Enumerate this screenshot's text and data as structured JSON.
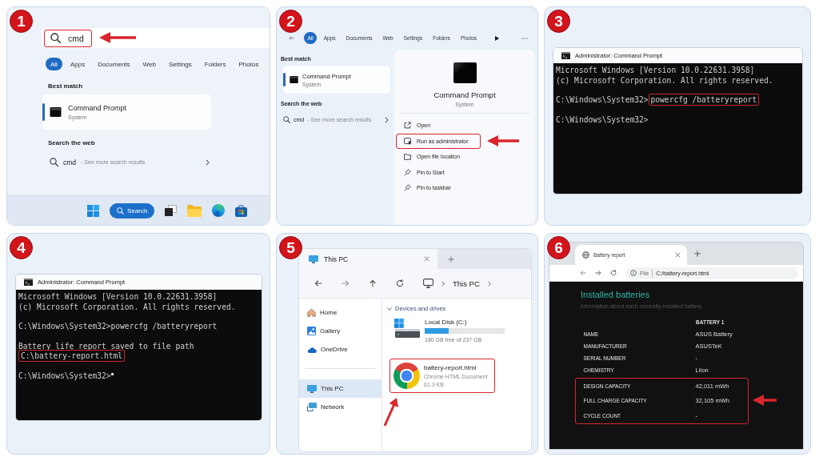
{
  "steps": [
    {
      "number": "1",
      "kind": "search",
      "search": {
        "value": "cmd",
        "highlighted": true
      },
      "filters": [
        {
          "label": "All",
          "selected": true
        },
        {
          "label": "Apps",
          "selected": false
        },
        {
          "label": "Documents",
          "selected": false
        },
        {
          "label": "Web",
          "selected": false
        },
        {
          "label": "Settings",
          "selected": false
        },
        {
          "label": "Folders",
          "selected": false
        },
        {
          "label": "Photos",
          "selected": false
        }
      ],
      "best_match_heading": "Best match",
      "best_match": {
        "title": "Command Prompt",
        "subtitle": "System",
        "selected": true
      },
      "web_heading": "Search the web",
      "web_result": {
        "query": "cmd",
        "hint": "- See more search results"
      },
      "taskbar": {
        "search_label": "Search"
      }
    },
    {
      "number": "2",
      "kind": "search_details",
      "filters": [
        {
          "label": "All",
          "selected": true
        },
        {
          "label": "Apps",
          "selected": false
        },
        {
          "label": "Documents",
          "selected": false
        },
        {
          "label": "Web",
          "selected": false
        },
        {
          "label": "Settings",
          "selected": false
        },
        {
          "label": "Folders",
          "selected": false
        },
        {
          "label": "Photos",
          "selected": false
        }
      ],
      "best_match_heading": "Best match",
      "best_match": {
        "title": "Command Prompt",
        "subtitle": "System",
        "selected": true
      },
      "web_heading": "Search the web",
      "web_result": {
        "query": "cmd",
        "hint": "- See more search results"
      },
      "details": {
        "title": "Command Prompt",
        "subtitle": "System",
        "actions": [
          {
            "label": "Open",
            "highlighted": false
          },
          {
            "label": "Run as administrator",
            "highlighted": true
          },
          {
            "label": "Open file location",
            "highlighted": false
          },
          {
            "label": "Pin to Start",
            "highlighted": false
          },
          {
            "label": "Pin to taskbar",
            "highlighted": false
          }
        ]
      }
    },
    {
      "number": "3",
      "kind": "terminal",
      "window_title": "Administrator: Command Prompt",
      "blocks": [
        {
          "lines": [
            {
              "text": "Microsoft Windows [Version 10.0.22631.3958]",
              "highlighted": false
            },
            {
              "text": "(c) Microsoft Corporation. All rights reserved.",
              "highlighted": false
            }
          ]
        },
        {
          "lines": [
            {
              "prompt": "C:\\Windows\\System32>",
              "text": "powercfg /batteryreport",
              "highlighted": true
            }
          ]
        },
        {
          "lines": [
            {
              "prompt": "C:\\Windows\\System32>"
            }
          ]
        }
      ]
    },
    {
      "number": "4",
      "kind": "terminal",
      "window_title": "Administrator: Command Prompt",
      "blocks": [
        {
          "lines": [
            {
              "text": "Microsoft Windows [Version 10.0.22631.3958]",
              "highlighted": false
            },
            {
              "text": "(c) Microsoft Corporation. All rights reserved.",
              "highlighted": false
            }
          ]
        },
        {
          "lines": [
            {
              "prompt": "C:\\Windows\\System32>",
              "text": "powercfg /batteryreport",
              "highlighted": false
            }
          ]
        },
        {
          "lines": [
            {
              "text": "Battery life report saved to file path",
              "highlighted": false
            },
            {
              "text": "C:\\battery-report.html",
              "highlighted": true
            }
          ]
        },
        {
          "lines": [
            {
              "prompt": "C:\\Windows\\System32>",
              "cursor": true
            }
          ]
        }
      ]
    },
    {
      "number": "5",
      "kind": "explorer",
      "tab_title": "This PC",
      "breadcrumb": "This PC",
      "sidebar": [
        {
          "items": [
            {
              "label": "Home",
              "selected": false
            },
            {
              "label": "Gallery",
              "selected": false
            },
            {
              "label": "OneDrive",
              "selected": false
            }
          ]
        },
        {
          "items": [
            {
              "label": "This PC",
              "selected": true
            },
            {
              "label": "Network",
              "selected": false
            }
          ]
        }
      ],
      "section": {
        "title": "Devices and drives",
        "expanded": true
      },
      "drive": {
        "name": "Local Disk (C:)",
        "level": 0.3,
        "free_text": "180 GB free of 237 GB"
      },
      "file": {
        "name": "battery-report.html",
        "type": "Chrome HTML Document",
        "size": "61.3 KB",
        "highlighted": true
      }
    },
    {
      "number": "6",
      "kind": "browser",
      "tab_title": "Battery report",
      "address": {
        "scheme": "File",
        "url": "C:/battery-report.html"
      },
      "report": {
        "title": "Installed batteries",
        "subtitle": "Information about each currently installed battery",
        "column_header": "BATTERY 1",
        "groups": [
          {
            "highlighted": false,
            "rows": [
              {
                "label": "NAME",
                "value": "ASUS Battery"
              },
              {
                "label": "MANUFACTURER",
                "value": "ASUSTeK"
              },
              {
                "label": "SERIAL NUMBER",
                "value": "-"
              },
              {
                "label": "CHEMISTRY",
                "value": "LiIon"
              }
            ]
          },
          {
            "highlighted": true,
            "rows": [
              {
                "label": "DESIGN CAPACITY",
                "value": "42,011 mWh"
              },
              {
                "label": "FULL CHARGE CAPACITY",
                "value": "32,105 mWh"
              },
              {
                "label": "CYCLE COUNT",
                "value": "-"
              }
            ]
          }
        ]
      }
    }
  ]
}
